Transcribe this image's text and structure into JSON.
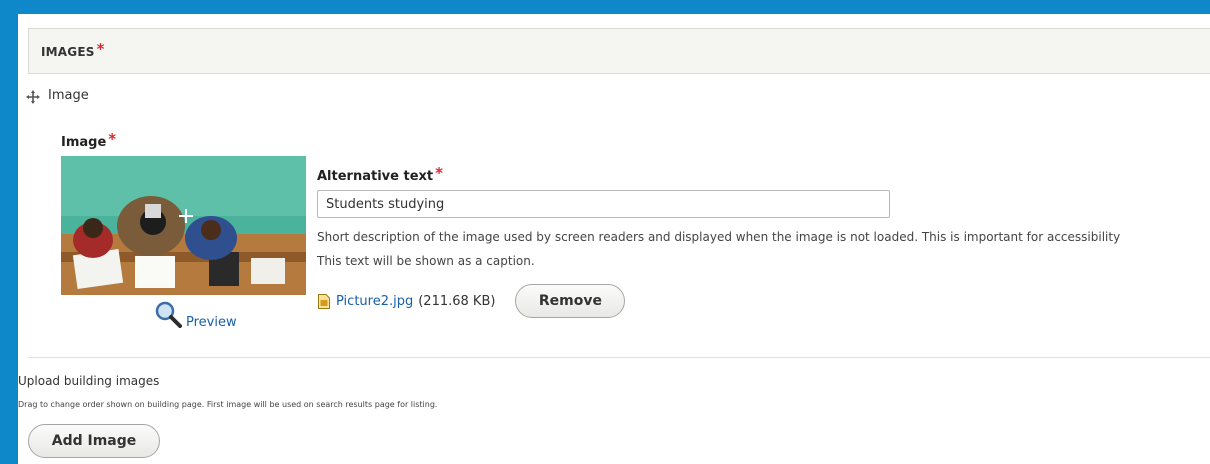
{
  "section": {
    "title": "IMAGES",
    "required_mark": "*"
  },
  "item": {
    "drag_label": "Image"
  },
  "image_field": {
    "label": "Image",
    "required_mark": "*",
    "preview_link": "Preview"
  },
  "alt_text": {
    "label": "Alternative text",
    "required_mark": "*",
    "value": "Students studying",
    "description": "Short description of the image used by screen readers and displayed when the image is not loaded. This is important for accessibility",
    "caption_note": "This text will be shown as a caption."
  },
  "file": {
    "name": "Picture2.jpg",
    "size": "(211.68 KB)",
    "remove_label": "Remove"
  },
  "upload": {
    "label": "Upload building images",
    "description": "Drag to change order shown on building page. First image will be used on search results page for listing.",
    "add_label": "Add Image"
  },
  "colors": {
    "frame": "#0f88c9",
    "link": "#1a5fa8",
    "required": "#e0272b"
  }
}
